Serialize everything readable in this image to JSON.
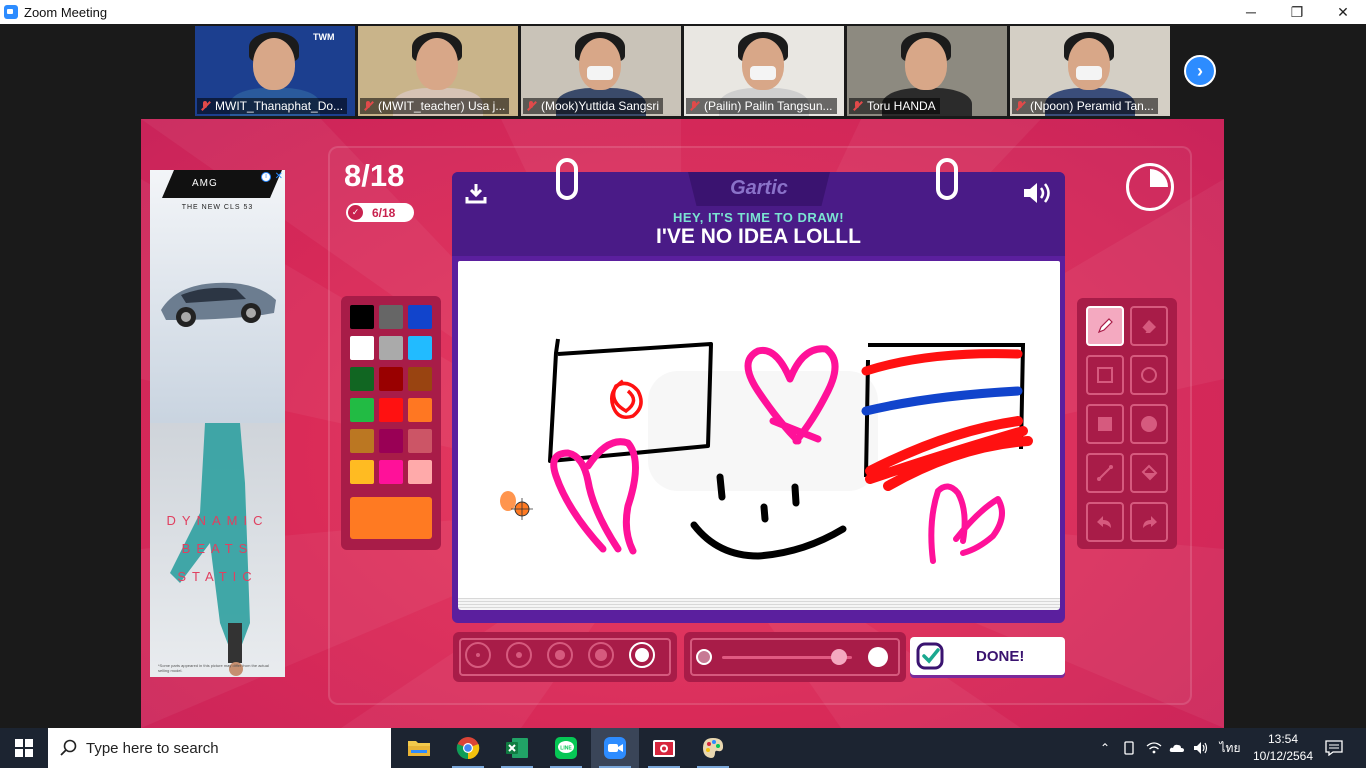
{
  "window": {
    "title": "Zoom Meeting"
  },
  "participants": [
    {
      "name": "MWIT_Thanaphat_Do...",
      "bg": "#1c3f8f",
      "body": "#2a5a9c",
      "logo": "TWM"
    },
    {
      "name": "(MWIT_teacher) Usa j...",
      "bg": "#c9b48a",
      "body": "#d6c3b5"
    },
    {
      "name": "(Mook)Yuttida Sangsri",
      "bg": "#c9c3b8",
      "body": "#3a4a6a"
    },
    {
      "name": "(Pailin) Pailin Tangsun...",
      "bg": "#e9e7e2",
      "body": "#cfcfcf"
    },
    {
      "name": "Toru HANDA",
      "bg": "#8d8a80",
      "body": "#2b2b2b"
    },
    {
      "name": "(Npoon) Peramid Tan...",
      "bg": "#d4cfc5",
      "body": "#3a4d7a"
    }
  ],
  "ad": {
    "brand": "AMG",
    "headline": "THE NEW CLS 53",
    "lines": [
      "DYNAMIC",
      "BEATS",
      "STATIC"
    ],
    "fineprint": "*Some parts appeared in this picture may differ from the actual selling model."
  },
  "game": {
    "logo": "Gartic",
    "round": "8/18",
    "done_count": "6/18",
    "prompt_hint": "HEY, IT'S TIME TO DRAW!",
    "prompt_word": "I'VE NO IDEA LOLLL",
    "done_label": "DONE!",
    "timer_elapsed": 0.25,
    "colors": [
      "#000000",
      "#666666",
      "#1144cc",
      "#ffffff",
      "#aaaaaa",
      "#22bbff",
      "#116622",
      "#990000",
      "#994411",
      "#22bb44",
      "#ff1111",
      "#ff7722",
      "#bb7722",
      "#990055",
      "#cc5566",
      "#ffbb22",
      "#ff1199",
      "#ffaaaa"
    ],
    "selected_color": "#ff7a22",
    "brush_sizes": [
      1,
      2,
      3,
      4,
      5
    ],
    "selected_size": 5,
    "opacity": 0.9
  },
  "taskbar": {
    "search_placeholder": "Type here to search",
    "language": "ไทย",
    "time": "13:54",
    "date": "10/12/2564"
  }
}
